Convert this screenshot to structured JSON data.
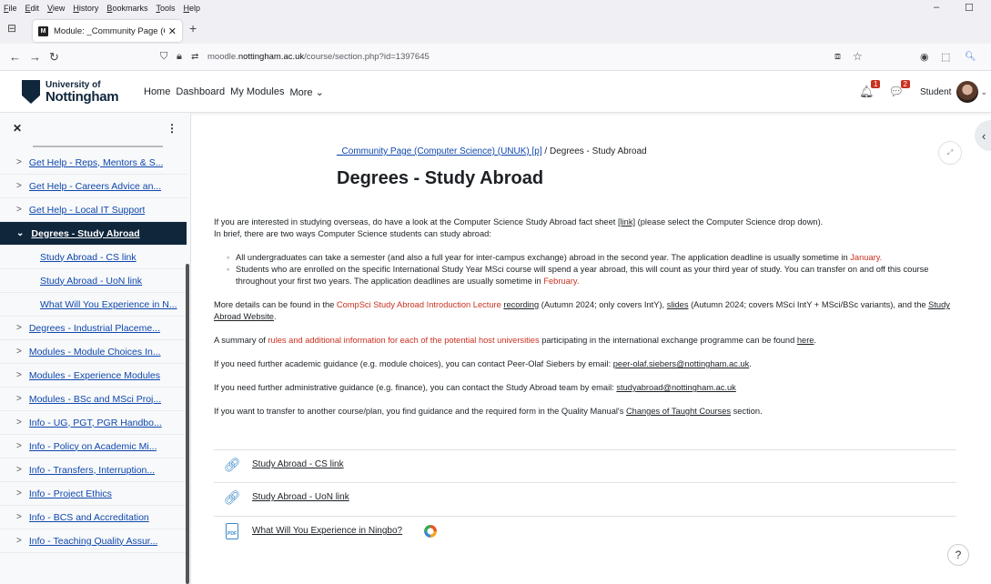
{
  "browser": {
    "menu": [
      "File",
      "Edit",
      "View",
      "History",
      "Bookmarks",
      "Tools",
      "Help"
    ],
    "tab_title": "Module: _Community Page (C",
    "url_prefix": "moodle.",
    "url_host": "nottingham.ac.uk",
    "url_path": "/course/section.php?id=1397645"
  },
  "header": {
    "logo_line1": "University of",
    "logo_line2": "Nottingham",
    "nav": [
      "Home",
      "Dashboard",
      "My Modules",
      "More ⌄"
    ],
    "notif_count": "1",
    "msg_count": "2",
    "user_label": "Student"
  },
  "drawer": {
    "items": [
      {
        "label": "Get Help - Reps, Mentors & S...",
        "type": "section"
      },
      {
        "label": "Get Help - Careers Advice an...",
        "type": "section"
      },
      {
        "label": "Get Help - Local IT Support",
        "type": "section"
      },
      {
        "label": "Degrees - Study Abroad",
        "type": "active"
      },
      {
        "label": "Study Abroad - CS link",
        "type": "sub"
      },
      {
        "label": "Study Abroad - UoN link",
        "type": "sub"
      },
      {
        "label": "What Will You Experience in N...",
        "type": "sub"
      },
      {
        "label": "Degrees - Industrial Placeme...",
        "type": "section"
      },
      {
        "label": "Modules - Module Choices In...",
        "type": "section"
      },
      {
        "label": "Modules - Experience Modules",
        "type": "section"
      },
      {
        "label": "Modules - BSc and MSci Proj...",
        "type": "section"
      },
      {
        "label": "Info - UG, PGT, PGR Handbo...",
        "type": "section"
      },
      {
        "label": "Info - Policy on Academic Mi...",
        "type": "section"
      },
      {
        "label": "Info - Transfers, Interruption...",
        "type": "section"
      },
      {
        "label": "Info - Project Ethics",
        "type": "section"
      },
      {
        "label": "Info - BCS and Accreditation",
        "type": "section"
      },
      {
        "label": "Info - Teaching Quality Assur...",
        "type": "section"
      }
    ]
  },
  "main": {
    "breadcrumb_link": "_Community Page (Computer Science) (UNUK) [p]",
    "breadcrumb_sep": " / ",
    "breadcrumb_current": "Degrees - Study Abroad",
    "title": "Degrees - Study Abroad",
    "p1a": "If you are interested in studying overseas, do have a look at the Computer Science Study Abroad fact sheet ",
    "p1_link": "[link]",
    "p1b": " (please select the Computer Science drop down).",
    "p1c": "In brief, there are two ways Computer Science students can study abroad:",
    "li1a": "All undergraduates can take a semester (and also a full year for inter-campus exchange) abroad in the second year. The application deadline is usually sometime in ",
    "li1_red": "January.",
    "li2a": "Students who are enrolled on the specific International Study Year MSci course will spend a year abroad, this will count as your third year of study. You can transfer on and off this course throughout your first two years. The application deadlines are usually sometime in ",
    "li2_red": "February.",
    "p2a": "More details can be found in the ",
    "p2_red": "CompSci Study Abroad Introduction Lecture",
    "p2_link1": "recording",
    "p2b": " (Autumn 2024; only covers IntY), ",
    "p2_link2": "slides",
    "p2c": " (Autumn 2024; covers MSci IntY + MSci/BSc variants), and the ",
    "p2_link3": "Study Abroad Website",
    "p2d": ".",
    "p3a": "A summary of ",
    "p3_red": "rules and additional information for each of the potential host universities",
    "p3b": " participating in the international exchange programme can be found ",
    "p3_link": "here",
    "p3c": ".",
    "p4a": "If you need further academic guidance (e.g. module choices), you can contact Peer-Olaf Siebers by email: ",
    "p4_link": "peer-olaf.siebers@nottingham.ac.uk",
    "p4b": ".",
    "p5a": "If you need further administrative guidance (e.g. finance), you can contact the Study Abroad team by email: ",
    "p5_link": "studyabroad@nottingham.ac.uk",
    "p6a": "If you want to transfer to another course/plan, you find guidance and the required form in the Quality Manual's ",
    "p6_link": "Changes of Taught Courses",
    "p6b": " section.",
    "activities": [
      {
        "label": "Study Abroad - CS link",
        "icon": "url-icon"
      },
      {
        "label": "Study Abroad - UoN link",
        "icon": "url-icon"
      },
      {
        "label": "What Will You Experience in Ningbo?",
        "icon": "pdf-icon"
      }
    ],
    "help": "?"
  }
}
